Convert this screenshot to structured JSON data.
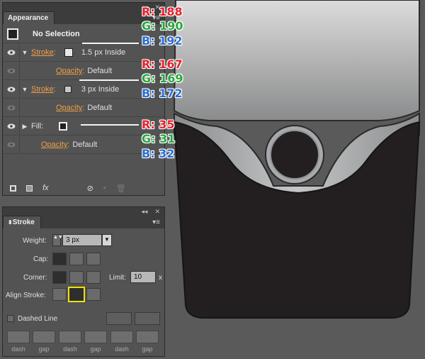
{
  "appearance_panel": {
    "tab_title": "Appearance",
    "selection_label": "No Selection",
    "rows": [
      {
        "label": "Stroke",
        "detail": "1.5 px  Inside"
      },
      {
        "label": "Opacity",
        "detail": "Default"
      },
      {
        "label": "Stroke",
        "detail": "3 px  Inside"
      },
      {
        "label": "Opacity",
        "detail": "Default"
      },
      {
        "label": "Fill",
        "detail": ""
      },
      {
        "label": "Opacity",
        "detail": "Default"
      }
    ],
    "bottom_fx": "fx"
  },
  "callouts": [
    {
      "r": "R: 188",
      "g": "G: 190",
      "b": "B: 192"
    },
    {
      "r": "R: 167",
      "g": "G: 169",
      "b": "B: 172"
    },
    {
      "r": "R: 35",
      "g": "G: 31",
      "b": "B: 32"
    }
  ],
  "stroke_panel": {
    "tab_title": "Stroke",
    "weight_label": "Weight:",
    "weight_value": "3 px",
    "cap_label": "Cap:",
    "corner_label": "Corner:",
    "limit_label": "Limit:",
    "limit_value": "10",
    "limit_unit": "x",
    "align_label": "Align Stroke:",
    "dashed_label": "Dashed Line",
    "dash_labels": [
      "dash",
      "gap",
      "dash",
      "gap",
      "dash",
      "gap"
    ]
  },
  "colors": {
    "stroke1": "#bcbec0",
    "stroke2": "#a7a9ac",
    "fill": "#231f20",
    "accent_link": "#f0a046",
    "align_highlight": "#f2e200"
  }
}
